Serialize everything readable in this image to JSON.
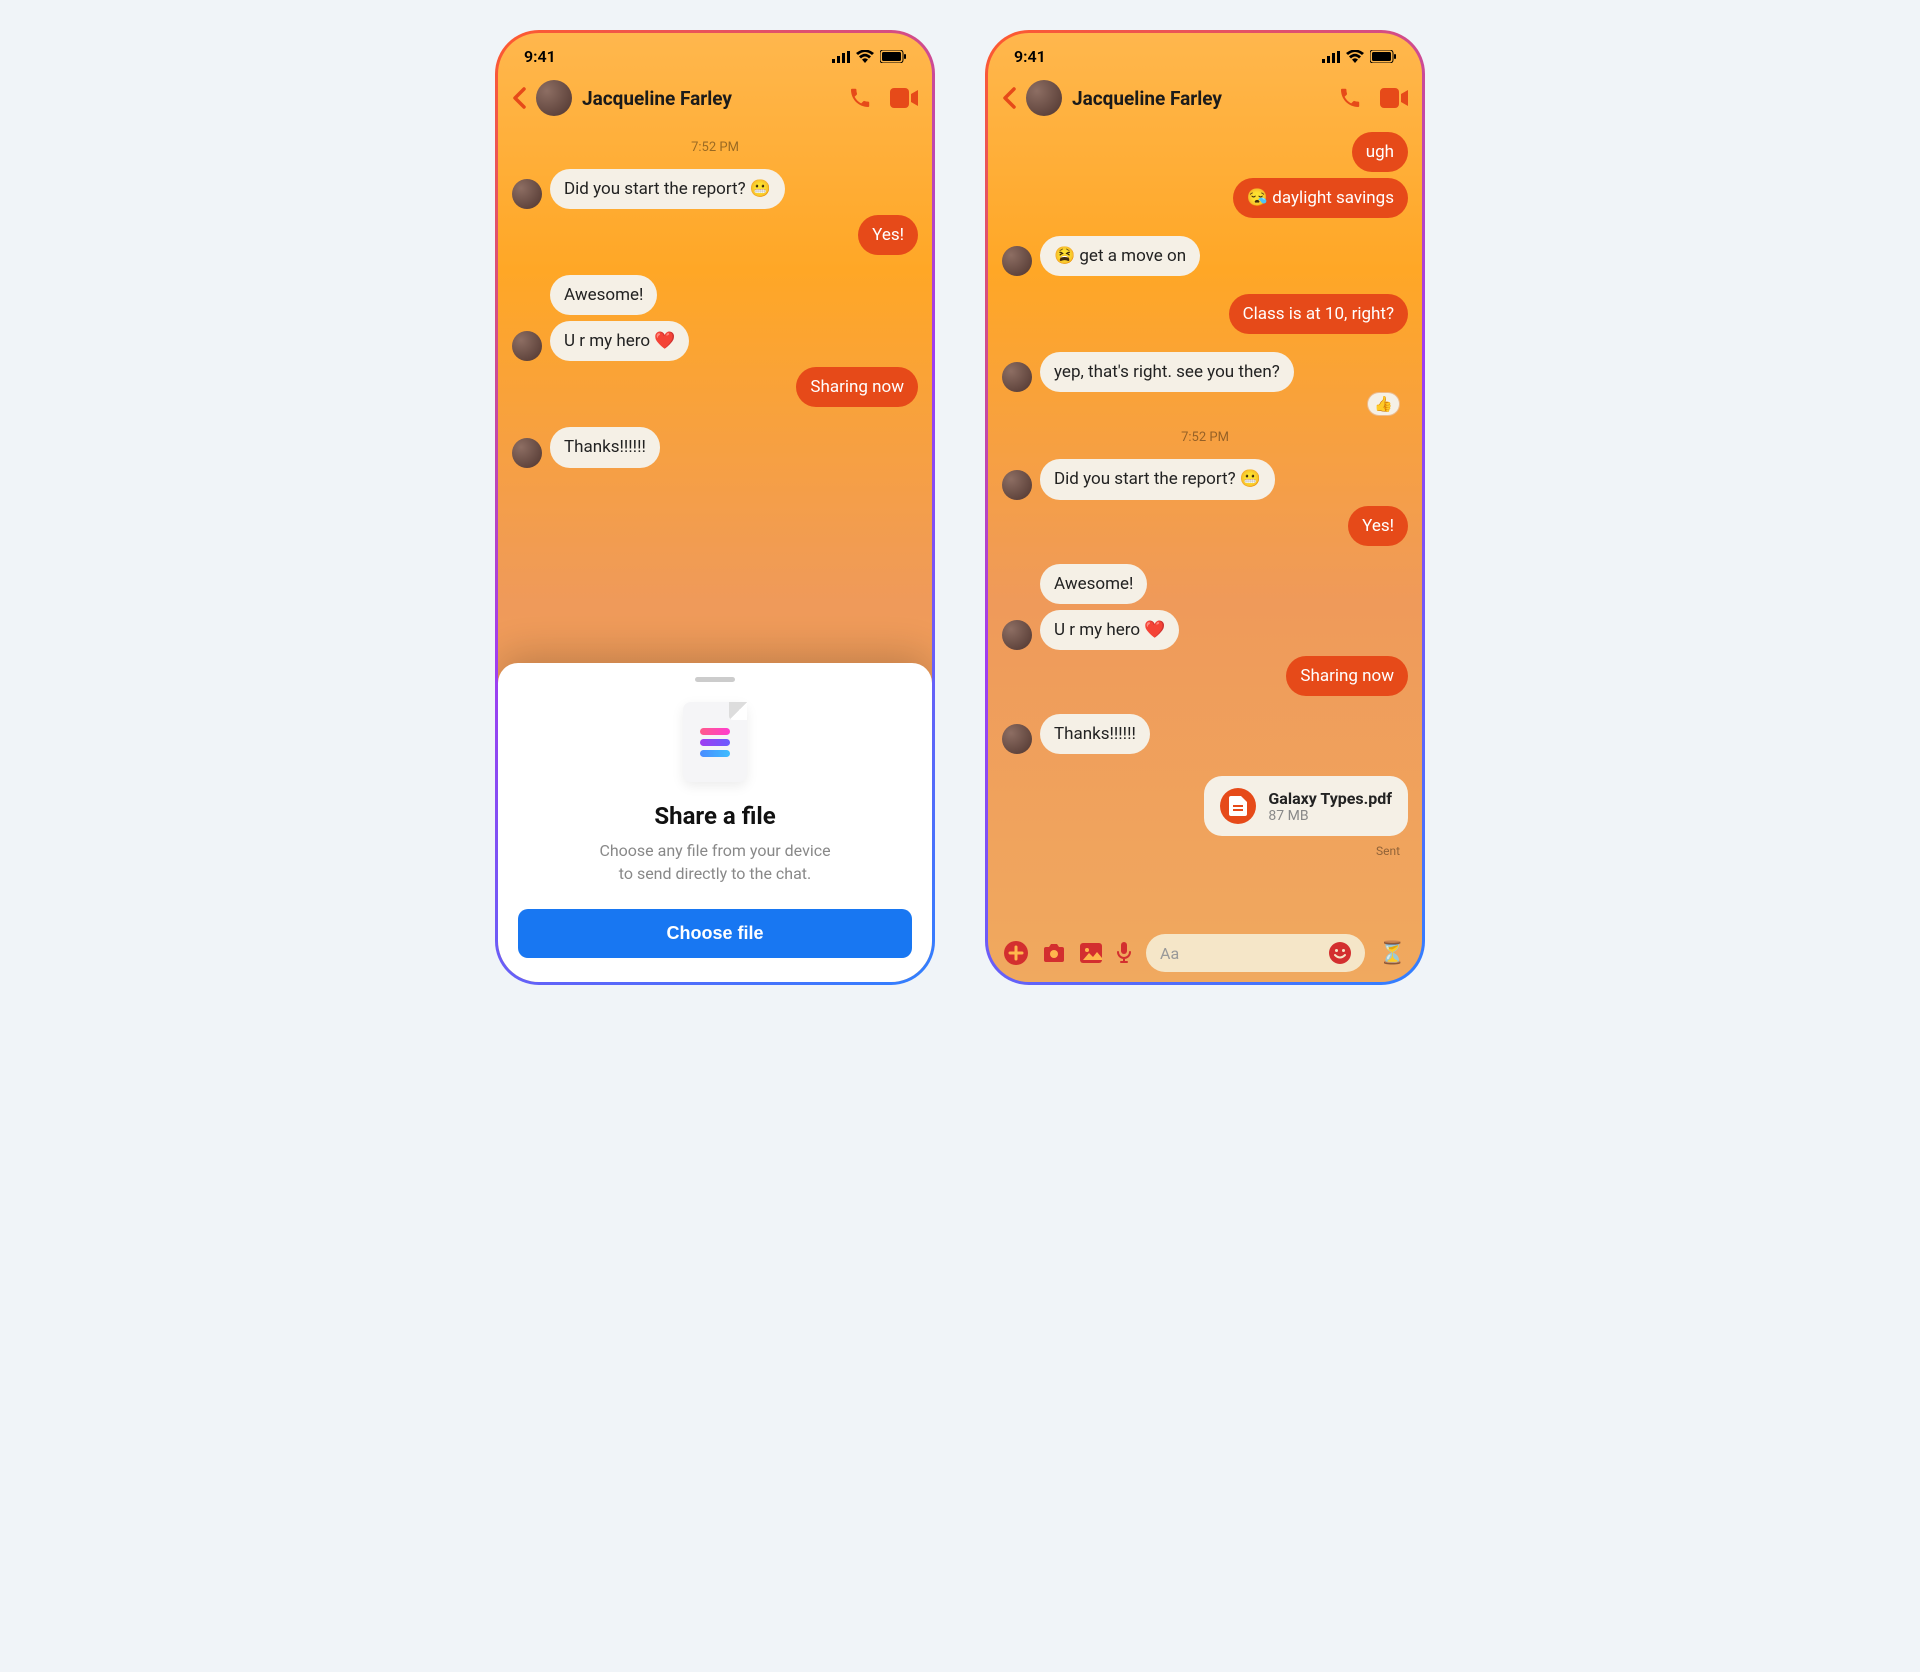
{
  "status": {
    "time": "9:41"
  },
  "contact": {
    "name": "Jacqueline Farley"
  },
  "input": {
    "placeholder": "Aa"
  },
  "sheet": {
    "title": "Share a file",
    "desc1": "Choose any file from your device",
    "desc2": "to send directly to the chat.",
    "button": "Choose file"
  },
  "left": {
    "ts1": "7:52 PM",
    "m1": "Did you start the report? 😬",
    "m2": "Yes!",
    "m3": "Awesome!",
    "m4": "U r my hero ❤️",
    "m5": "Sharing now",
    "m6": "Thanks!!!!!!"
  },
  "right": {
    "m1": "ugh",
    "m2": "😪 daylight savings",
    "m3": "😫 get a move on",
    "m4": "Class is at 10, right?",
    "m5": "yep, that's right. see you then?",
    "reaction": "👍",
    "ts1": "7:52 PM",
    "m6": "Did you start the report? 😬",
    "m7": "Yes!",
    "m8": "Awesome!",
    "m9": "U r my hero ❤️",
    "m10": "Sharing now",
    "m11": "Thanks!!!!!!",
    "file": {
      "name": "Galaxy Types.pdf",
      "size": "87 MB"
    },
    "sent": "Sent"
  }
}
